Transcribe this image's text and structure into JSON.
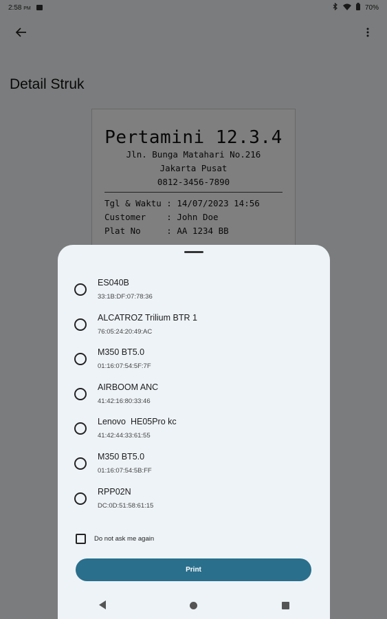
{
  "status_bar": {
    "time": "2:58",
    "ampm": "PM",
    "battery": "70%",
    "icons": [
      "image-notification-icon",
      "bluetooth-icon",
      "wifi-icon",
      "battery-icon"
    ]
  },
  "toolbar": {
    "back_icon": "arrow-back-icon",
    "menu_icon": "more-vert-icon"
  },
  "page": {
    "title": "Detail Struk"
  },
  "receipt": {
    "store_name": "Pertamini 12.3.4",
    "address": "Jln. Bunga Matahari No.216",
    "city": "Jakarta Pusat",
    "phone": "0812-3456-7890",
    "fields": [
      {
        "text": "Tgl & Waktu : 14/07/2023 14:56"
      },
      {
        "text": "Customer    : John Doe"
      },
      {
        "text": "Plat No     : AA 1234 BB"
      }
    ]
  },
  "sheet": {
    "devices": [
      {
        "name": "ES040B",
        "mac": "33:1B:DF:07:78:36"
      },
      {
        "name": "ALCATROZ Trilium BTR 1",
        "mac": "76:05:24:20:49:AC"
      },
      {
        "name": "M350 BT5.0",
        "mac": "01:16:07:54:5F:7F"
      },
      {
        "name": "AIRBOOM ANC",
        "mac": "41:42:16:80:33:46"
      },
      {
        "name": "Lenovo  HE05Pro kc",
        "mac": "41:42:44:33:61:55"
      },
      {
        "name": "M350 BT5.0",
        "mac": "01:16:07:54:5B:FF"
      },
      {
        "name": "RPP02N",
        "mac": "DC:0D:51:58:61:15"
      }
    ],
    "dont_ask_label": "Do not ask me again",
    "print_label": "Print"
  },
  "colors": {
    "accent": "#2a6f8c",
    "sheet_bg": "#eef3f7"
  }
}
